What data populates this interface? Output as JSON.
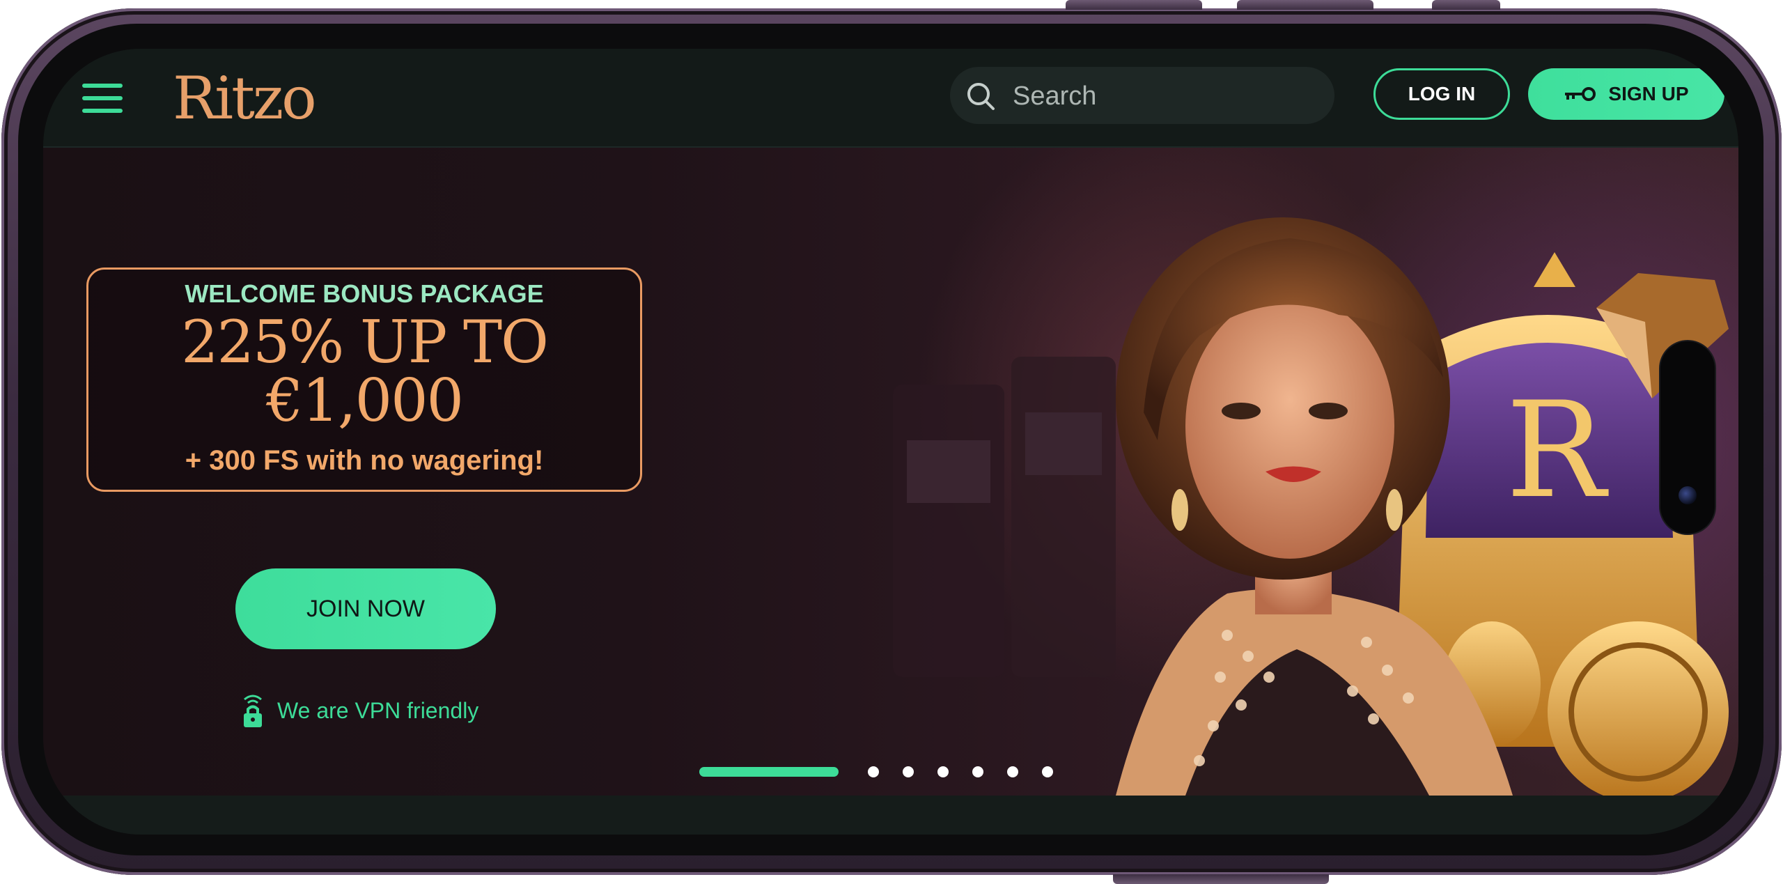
{
  "header": {
    "logo": "Ritzo",
    "search_placeholder": "Search",
    "login_label": "LOG IN",
    "signup_label": "SIGN UP"
  },
  "hero": {
    "bonus_title": "WELCOME BONUS PACKAGE",
    "bonus_amount": "225% UP TO\n€1,000",
    "bonus_sub": "+ 300 FS with no wagering!",
    "join_label": "JOIN NOW",
    "vpn_text": "We are VPN friendly",
    "carousel": {
      "total_slides": 7,
      "active_index": 0
    }
  },
  "colors": {
    "accent": "#3ddc98",
    "gold": "#f2a86a",
    "header_bg": "#131a18",
    "hero_bg": "#1f1218"
  },
  "icons": [
    "menu-icon",
    "search-icon",
    "key-icon",
    "lock-wifi-icon"
  ]
}
